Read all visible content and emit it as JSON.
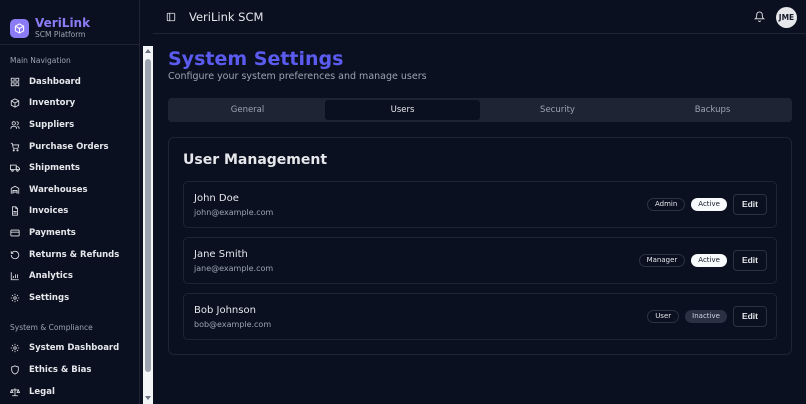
{
  "brand": {
    "name": "VeriLink",
    "subtitle": "SCM Platform"
  },
  "sidebar": {
    "main_label": "Main Navigation",
    "main_items": [
      {
        "label": "Dashboard",
        "icon": "grid-icon"
      },
      {
        "label": "Inventory",
        "icon": "box-icon"
      },
      {
        "label": "Suppliers",
        "icon": "users-icon"
      },
      {
        "label": "Purchase Orders",
        "icon": "cart-icon"
      },
      {
        "label": "Shipments",
        "icon": "truck-icon"
      },
      {
        "label": "Warehouses",
        "icon": "warehouse-icon"
      },
      {
        "label": "Invoices",
        "icon": "file-icon"
      },
      {
        "label": "Payments",
        "icon": "credit-card-icon"
      },
      {
        "label": "Returns & Refunds",
        "icon": "refresh-icon"
      },
      {
        "label": "Analytics",
        "icon": "bar-chart-icon"
      },
      {
        "label": "Settings",
        "icon": "gear-icon"
      }
    ],
    "compliance_label": "System & Compliance",
    "compliance_items": [
      {
        "label": "System Dashboard",
        "icon": "gear-icon"
      },
      {
        "label": "Ethics & Bias",
        "icon": "shield-icon"
      },
      {
        "label": "Legal",
        "icon": "scale-icon"
      }
    ]
  },
  "topbar": {
    "title": "VeriLink SCM",
    "avatar": "JME"
  },
  "page": {
    "title": "System Settings",
    "subtitle": "Configure your system preferences and manage users"
  },
  "tabs": [
    {
      "label": "General",
      "active": false
    },
    {
      "label": "Users",
      "active": true
    },
    {
      "label": "Security",
      "active": false
    },
    {
      "label": "Backups",
      "active": false
    }
  ],
  "users_card": {
    "title": "User Management",
    "edit_label": "Edit",
    "users": [
      {
        "name": "John Doe",
        "email": "john@example.com",
        "role": "Admin",
        "status": "Active"
      },
      {
        "name": "Jane Smith",
        "email": "jane@example.com",
        "role": "Manager",
        "status": "Active"
      },
      {
        "name": "Bob Johnson",
        "email": "bob@example.com",
        "role": "User",
        "status": "Inactive"
      }
    ]
  },
  "colors": {
    "accent": "#5b5bf0",
    "brand": "#8b7cf6",
    "background": "#0b1020",
    "border": "#1e2433"
  }
}
